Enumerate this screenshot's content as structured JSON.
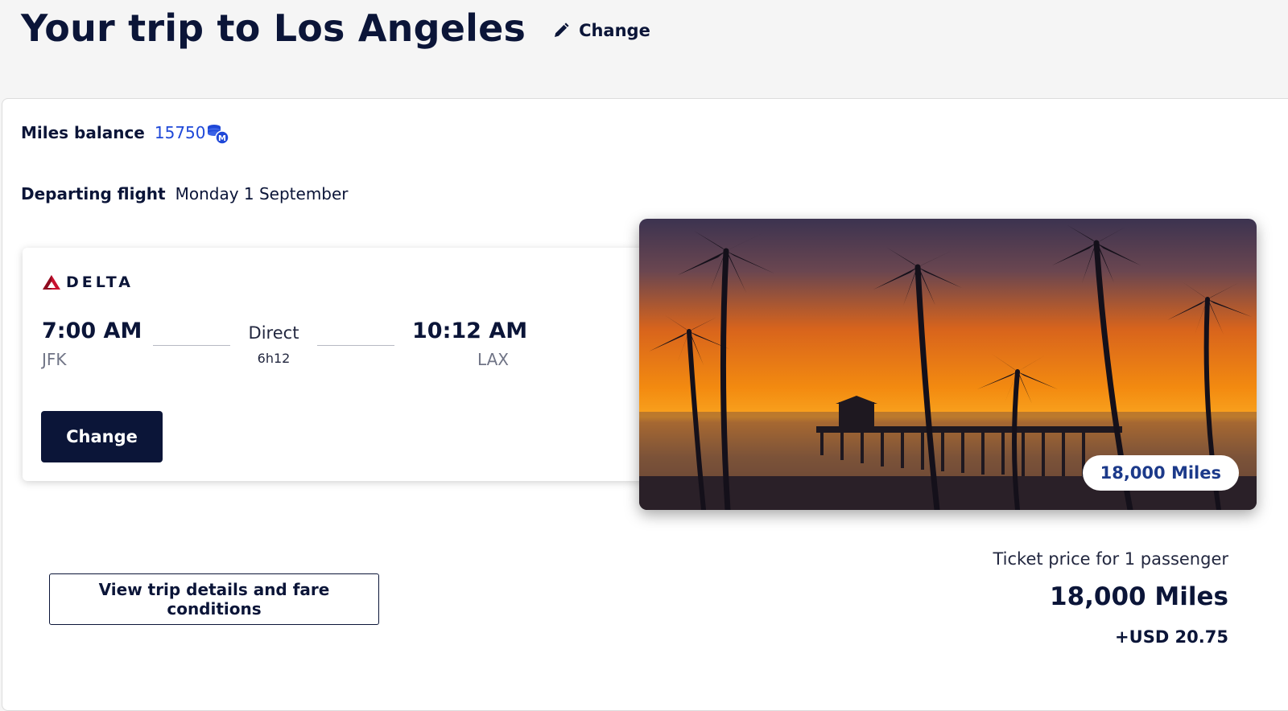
{
  "header": {
    "title": "Your trip to Los Angeles",
    "edit_label": "Change"
  },
  "miles_balance": {
    "label": "Miles balance",
    "value": "15750",
    "icon": "miles-coins-icon"
  },
  "departing": {
    "label": "Departing flight",
    "date": "Monday 1 September"
  },
  "flight": {
    "airline": "DELTA",
    "departure_time": "7:00 AM",
    "departure_airport": "JFK",
    "stops": "Direct",
    "duration": "6h12",
    "arrival_time": "10:12 AM",
    "arrival_airport": "LAX",
    "change_button": "Change"
  },
  "destination": {
    "badge": "18,000 Miles"
  },
  "fare_details_button": "View trip details and fare conditions",
  "price": {
    "caption": "Ticket price for 1 passenger",
    "miles": "18,000 Miles",
    "cash": "+USD 20.75"
  },
  "colors": {
    "navy": "#0b1538",
    "link_blue": "#1f48d8",
    "delta_red": "#c8102e"
  }
}
